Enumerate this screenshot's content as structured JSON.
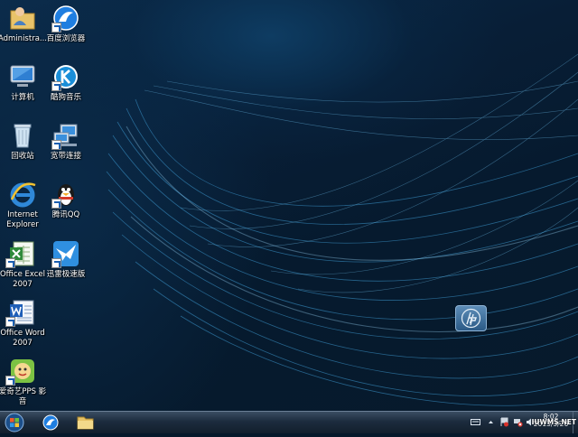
{
  "desktop": {
    "icons": [
      {
        "name": "administrator-folder",
        "label": "Administra..."
      },
      {
        "name": "baidu-browser",
        "label": "百度浏览器"
      },
      {
        "name": "computer",
        "label": "计算机"
      },
      {
        "name": "kuwo-music",
        "label": "酷狗音乐"
      },
      {
        "name": "recycle-bin",
        "label": "回收站"
      },
      {
        "name": "broadband-connection",
        "label": "宽带连接"
      },
      {
        "name": "internet-explorer",
        "label": "Internet Explorer"
      },
      {
        "name": "tencent-qq",
        "label": "腾讯QQ"
      },
      {
        "name": "office-excel-2007",
        "label": "Office Excel 2007"
      },
      {
        "name": "xunlei-speed",
        "label": "迅雷极速版"
      },
      {
        "name": "office-word-2007",
        "label": "Office Word 2007"
      },
      {
        "name": "iqiyi-pps",
        "label": "爱奇艺PPS 影音"
      }
    ],
    "brand_logo_text": "hp"
  },
  "taskbar": {
    "clock_time": "8:02",
    "clock_date": "2013/3/26",
    "watermark": "IUWMS.NET"
  },
  "colors": {
    "desktop_background": "#071a2c",
    "taskbar": "#1c2c3e",
    "swirl": "#3f9fd8"
  }
}
